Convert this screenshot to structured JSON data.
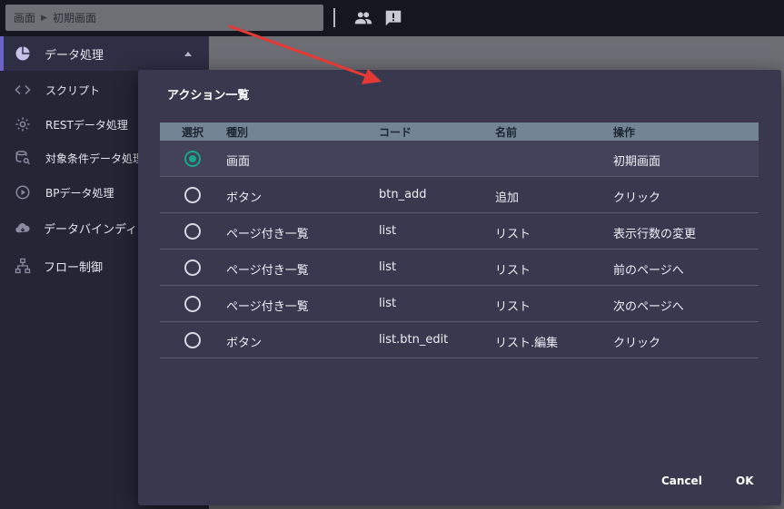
{
  "breadcrumb": {
    "root": "画面",
    "current": "初期画面"
  },
  "toolbar": {
    "icons": [
      "people-icon",
      "feedback-icon"
    ]
  },
  "sidebar": {
    "items": [
      {
        "label": "データ処理",
        "icon": "chart-pie-icon"
      },
      {
        "label": "スクリプト",
        "icon": "code-icon"
      },
      {
        "label": "RESTデータ処理",
        "icon": "gear-icon"
      },
      {
        "label": "対象条件データ処理",
        "icon": "database-search-icon"
      },
      {
        "label": "BPデータ処理",
        "icon": "play-circle-icon"
      },
      {
        "label": "データバインディング",
        "icon": "cloud-icon"
      },
      {
        "label": "フロー制御",
        "icon": "flow-icon"
      }
    ]
  },
  "dialog": {
    "title": "アクション一覧",
    "columns": [
      "選択",
      "種別",
      "コード",
      "名前",
      "操作"
    ],
    "rows": [
      {
        "kind": "画面",
        "code": "",
        "name": "",
        "action": "初期画面",
        "selected": true
      },
      {
        "kind": "ボタン",
        "code": "btn_add",
        "name": "追加",
        "action": "クリック",
        "selected": false
      },
      {
        "kind": "ページ付き一覧",
        "code": "list",
        "name": "リスト",
        "action": "表示行数の変更",
        "selected": false
      },
      {
        "kind": "ページ付き一覧",
        "code": "list",
        "name": "リスト",
        "action": "前のページへ",
        "selected": false
      },
      {
        "kind": "ページ付き一覧",
        "code": "list",
        "name": "リスト",
        "action": "次のページへ",
        "selected": false
      },
      {
        "kind": "ボタン",
        "code": "list.btn_edit",
        "name": "リスト.編集",
        "action": "クリック",
        "selected": false
      }
    ],
    "cancel_label": "Cancel",
    "ok_label": "OK"
  },
  "colors": {
    "accent": "#6c63c7",
    "radio_selected": "#16a889",
    "annotation_arrow": "#e53935"
  }
}
